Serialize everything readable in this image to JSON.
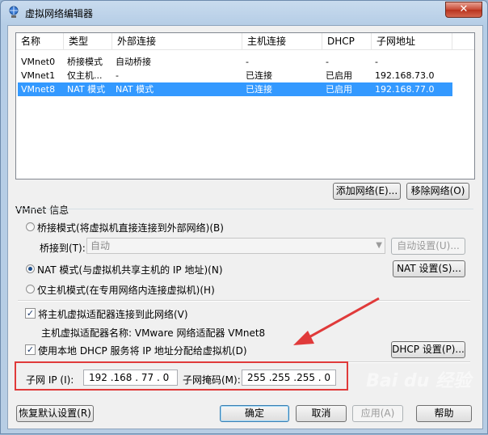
{
  "window": {
    "title": "虚拟网络编辑器",
    "close_icon": "close-icon"
  },
  "network_list": {
    "columns": [
      "名称",
      "类型",
      "外部连接",
      "主机连接",
      "DHCP",
      "子网地址"
    ],
    "rows": [
      {
        "name": "VMnet0",
        "type": "桥接模式",
        "external": "自动桥接",
        "host": "-",
        "dhcp": "-",
        "subnet": "-"
      },
      {
        "name": "VMnet1",
        "type": "仅主机...",
        "external": "-",
        "host": "已连接",
        "dhcp": "已启用",
        "subnet": "192.168.73.0"
      },
      {
        "name": "VMnet8",
        "type": "NAT 模式",
        "external": "NAT 模式",
        "host": "已连接",
        "dhcp": "已启用",
        "subnet": "192.168.77.0",
        "selected": true
      }
    ]
  },
  "buttons": {
    "add_network": "添加网络(E)...",
    "remove_network": "移除网络(O)",
    "auto_settings": "自动设置(U)...",
    "nat_settings": "NAT 设置(S)...",
    "dhcp_settings": "DHCP 设置(P)...",
    "restore_defaults": "恢复默认设置(R)",
    "ok": "确定",
    "cancel": "取消",
    "apply": "应用(A)",
    "help": "帮助"
  },
  "vmnet_info": {
    "group_label": "VMnet 信息",
    "bridged_mode": "桥接模式(将虚拟机直接连接到外部网络)(B)",
    "bridged_to_label": "桥接到(T):",
    "bridged_to_value": "自动",
    "nat_mode": "NAT 模式(与虚拟机共享主机的 IP 地址)(N)",
    "host_only_mode": "仅主机模式(在专用网络内连接虚拟机)(H)",
    "connect_host_adapter": "将主机虚拟适配器连接到此网络(V)",
    "adapter_name": "主机虚拟适配器名称: VMware 网络适配器 VMnet8",
    "use_dhcp": "使用本地 DHCP 服务将 IP 地址分配给虚拟机(D)",
    "subnet_ip_label": "子网 IP (I):",
    "subnet_ip_value": "192 .168 . 77 . 0",
    "subnet_mask_label": "子网掩码(M):",
    "subnet_mask_value": "255 .255 .255 . 0",
    "selected_mode": "nat",
    "connect_host_adapter_checked": true,
    "use_dhcp_checked": true
  },
  "colors": {
    "selection": "#3399ff",
    "annotation": "#e03a3a"
  },
  "watermark": "Bai du 经验"
}
